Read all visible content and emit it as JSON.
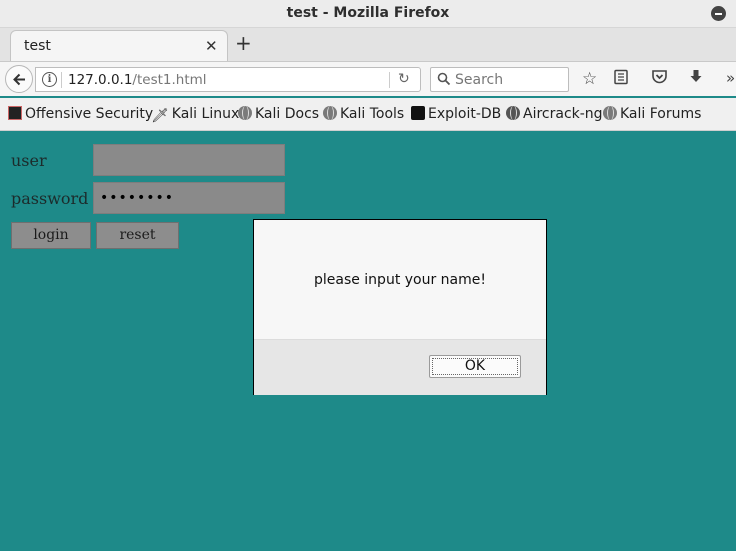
{
  "window": {
    "title": "test - Mozilla Firefox"
  },
  "tabs": [
    {
      "label": "test"
    }
  ],
  "navbar": {
    "url_host": "127.0.0.1",
    "url_path": "/test1.html",
    "search_placeholder": "Search"
  },
  "bookmarks": [
    {
      "label": "Offensive Security",
      "icon": "offsec-icon"
    },
    {
      "label": "Kali Linux",
      "icon": "kali-dragon-icon"
    },
    {
      "label": "Kali Docs",
      "icon": "globe-icon"
    },
    {
      "label": "Kali Tools",
      "icon": "globe-icon"
    },
    {
      "label": "Exploit-DB",
      "icon": "exploit-db-icon"
    },
    {
      "label": "Aircrack-ng",
      "icon": "aircrack-icon"
    },
    {
      "label": "Kali Forums",
      "icon": "globe-icon"
    }
  ],
  "form": {
    "user_label": "user",
    "password_label": "password",
    "user_value": "",
    "password_value": "••••••••",
    "login_label": "login",
    "reset_label": "reset"
  },
  "dialog": {
    "message": "please input your name!",
    "ok_label": "OK"
  },
  "colors": {
    "page_bg": "#1e8a89",
    "field_bg": "#8a8a8a"
  }
}
